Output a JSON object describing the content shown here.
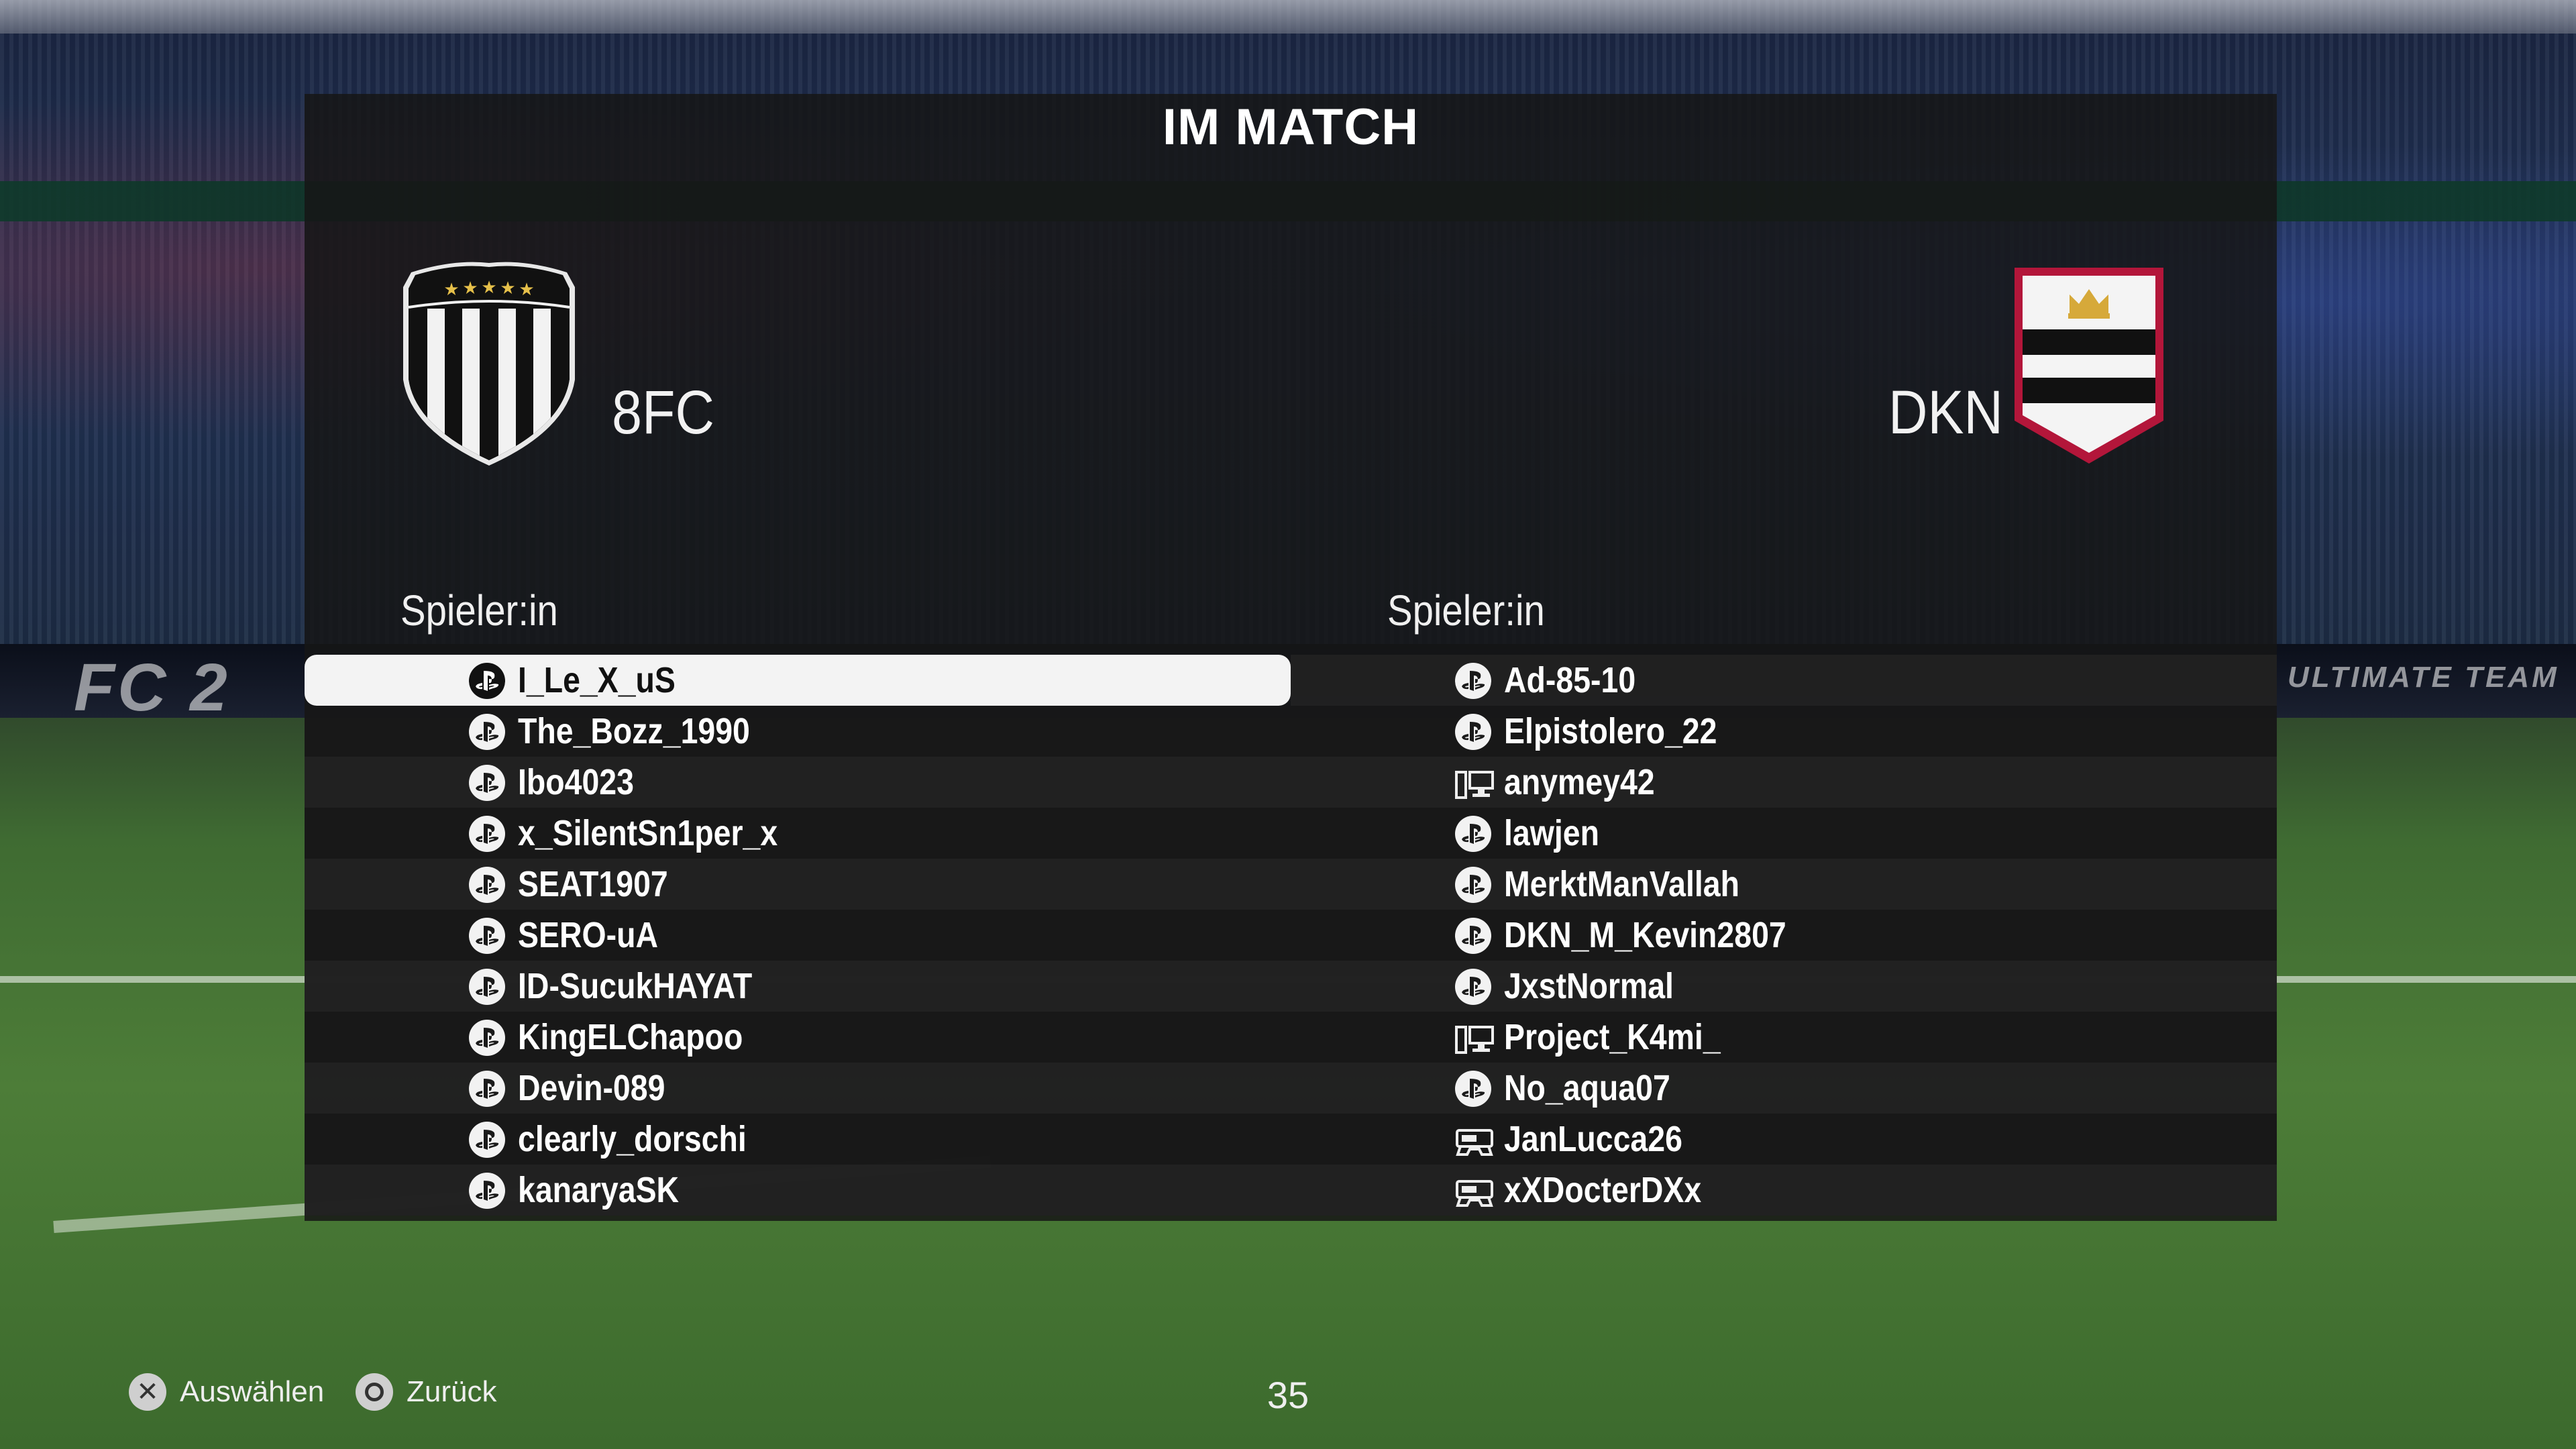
{
  "screen": {
    "title": "IM MATCH",
    "timer": "35"
  },
  "background": {
    "board_left": "FC 2",
    "board_right": "ULTIMATE TEAM"
  },
  "home": {
    "name": "8FC",
    "crest": "black-white-striped-shield-with-five-gold-stars",
    "column_header": "Spieler:in",
    "players": [
      {
        "name": "I_Le_X_uS",
        "platform": "playstation-icon",
        "selected": true
      },
      {
        "name": "The_Bozz_1990",
        "platform": "playstation-icon"
      },
      {
        "name": "Ibo4023",
        "platform": "playstation-icon"
      },
      {
        "name": "x_SilentSn1per_x",
        "platform": "playstation-icon"
      },
      {
        "name": "SEAT1907",
        "platform": "playstation-icon"
      },
      {
        "name": "SERO-uA",
        "platform": "playstation-icon"
      },
      {
        "name": "ID-SucukHAYAT",
        "platform": "playstation-icon"
      },
      {
        "name": "KingELChapoo",
        "platform": "playstation-icon"
      },
      {
        "name": "Devin-089",
        "platform": "playstation-icon"
      },
      {
        "name": "clearly_dorschi",
        "platform": "playstation-icon"
      },
      {
        "name": "kanaryaSK",
        "platform": "playstation-icon"
      }
    ]
  },
  "away": {
    "name": "DKN",
    "crest": "white-shield-red-border-black-stripes-gold-crown",
    "column_header": "Spieler:in",
    "players": [
      {
        "name": "Ad-85-10",
        "platform": "playstation-icon"
      },
      {
        "name": "Elpistolero_22",
        "platform": "playstation-icon"
      },
      {
        "name": "anymey42",
        "platform": "pc-icon"
      },
      {
        "name": "lawjen",
        "platform": "playstation-icon"
      },
      {
        "name": "MerktManVallah",
        "platform": "playstation-icon"
      },
      {
        "name": "DKN_M_Kevin2807",
        "platform": "playstation-icon"
      },
      {
        "name": "JxstNormal",
        "platform": "playstation-icon"
      },
      {
        "name": "Project_K4mi_",
        "platform": "pc-icon"
      },
      {
        "name": "No_aqua07",
        "platform": "playstation-icon"
      },
      {
        "name": "JanLucca26",
        "platform": "xbox-icon"
      },
      {
        "name": "xXDocterDXx",
        "platform": "xbox-icon"
      }
    ]
  },
  "footer": {
    "select_label": "Auswählen",
    "back_label": "Zurück",
    "select_button_icon": "cross-button-icon",
    "back_button_icon": "circle-button-icon"
  },
  "colors": {
    "panel": "#161616",
    "selected_row": "#f3f3f3",
    "gold": "#d6a93a",
    "away_border": "#b3163a"
  }
}
